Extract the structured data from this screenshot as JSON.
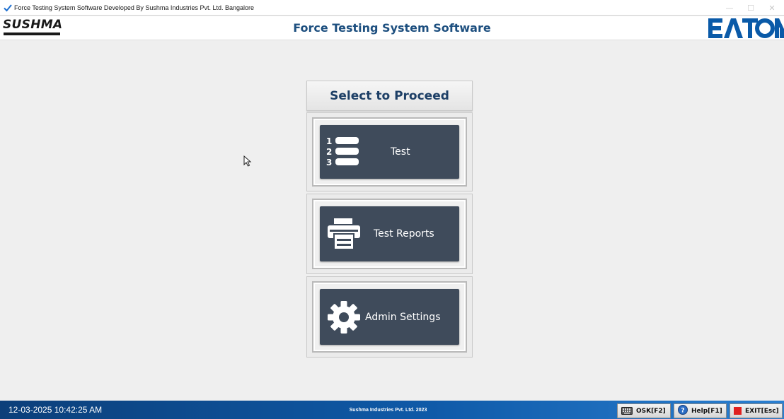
{
  "window": {
    "title": "Force Testing System Software Developed By Sushma Industries Pvt. Ltd. Bangalore",
    "minimize": "—",
    "maximize": "☐",
    "close": "✕"
  },
  "header": {
    "left_logo": "SUSHMA",
    "app_title": "Force Testing System Software",
    "right_logo": "EATON"
  },
  "menu": {
    "heading": "Select to Proceed",
    "items": [
      {
        "label": "Test",
        "icon": "numbered-list-icon",
        "icon_numbers": [
          "1",
          "2",
          "3"
        ]
      },
      {
        "label": "Test Reports",
        "icon": "printer-icon"
      },
      {
        "label": "Admin Settings",
        "icon": "gear-icon"
      }
    ]
  },
  "statusbar": {
    "datetime": "12-03-2025 10:42:25 AM",
    "copyright": "Sushma Industries Pvt. Ltd. 2023",
    "buttons": [
      {
        "label": "OSK[F2]",
        "icon": "keyboard-icon"
      },
      {
        "label": "Help[F1]",
        "icon": "help-icon"
      },
      {
        "label": "EXIT[Esc]",
        "icon": "stop-icon"
      }
    ]
  },
  "colors": {
    "title_blue": "#1d4f7f",
    "button_bg": "#3f4b5b",
    "eaton_blue": "#0a5aa8",
    "statusbar_dark": "#0c3f7a",
    "exit_red": "#e02020"
  }
}
